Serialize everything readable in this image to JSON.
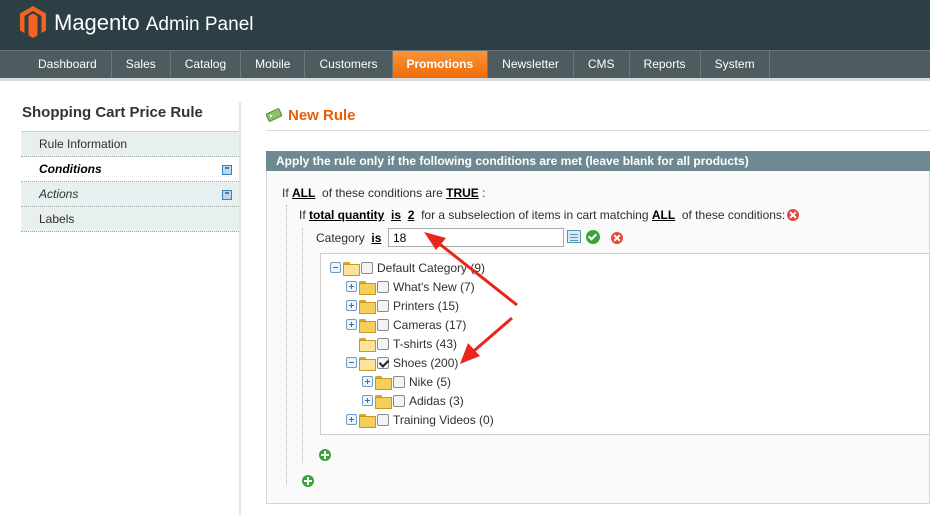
{
  "app": {
    "brand": "Magento",
    "brand_suffix": "Admin Panel"
  },
  "nav": {
    "items": [
      "Dashboard",
      "Sales",
      "Catalog",
      "Mobile",
      "Customers",
      "Promotions",
      "Newsletter",
      "CMS",
      "Reports",
      "System"
    ],
    "active": "Promotions"
  },
  "sidebar": {
    "title": "Shopping Cart Price Rule",
    "tabs": [
      "Rule Information",
      "Conditions",
      "Actions",
      "Labels"
    ],
    "active_tab": "Conditions"
  },
  "page": {
    "title": "New Rule"
  },
  "conditions": {
    "header": "Apply the rule only if the following conditions are met (leave blank for all products)",
    "root": {
      "prefix": "If",
      "aggregator": "ALL",
      "middle": "of these conditions are",
      "value": "TRUE",
      "suffix": ":"
    },
    "sub": {
      "prefix": "If",
      "attribute": "total quantity",
      "operator": "is",
      "value": "2",
      "middle": "for a subselection of items in cart matching",
      "aggregator": "ALL",
      "suffix": "of these conditions:"
    },
    "category": {
      "label": "Category",
      "operator": "is",
      "value": "18"
    }
  },
  "tree": {
    "nodes": [
      {
        "label": "Default Category (9)",
        "checked": false
      },
      {
        "label": "What's New (7)",
        "checked": false
      },
      {
        "label": "Printers (15)",
        "checked": false
      },
      {
        "label": "Cameras (17)",
        "checked": false
      },
      {
        "label": "T-shirts (43)",
        "checked": false
      },
      {
        "label": "Shoes (200)",
        "checked": true
      },
      {
        "label": "Nike (5)",
        "checked": false
      },
      {
        "label": "Adidas (3)",
        "checked": false
      },
      {
        "label": "Training Videos (0)",
        "checked": false
      }
    ]
  },
  "colors": {
    "header_bg": "#2b3f45",
    "nav_bg": "#4e5b5f",
    "accent_orange": "#f06a05",
    "title_orange": "#eb5e00",
    "fieldset_head": "#6f8992",
    "annotation_arrow": "#e8261c"
  }
}
